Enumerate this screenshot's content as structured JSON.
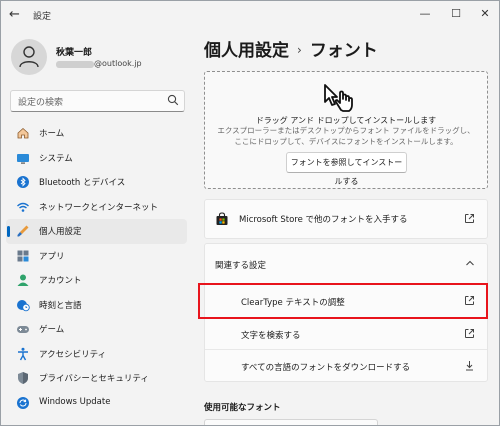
{
  "window": {
    "title": "設定"
  },
  "user": {
    "name": "秋葉一郎",
    "email_domain": "@outlook.jp"
  },
  "search": {
    "placeholder": "設定の検索"
  },
  "nav": {
    "items": [
      {
        "label": "ホーム",
        "icon": "home-icon"
      },
      {
        "label": "システム",
        "icon": "system-icon"
      },
      {
        "label": "Bluetooth とデバイス",
        "icon": "bluetooth-icon"
      },
      {
        "label": "ネットワークとインターネット",
        "icon": "wifi-icon"
      },
      {
        "label": "個人用設定",
        "icon": "brush-icon"
      },
      {
        "label": "アプリ",
        "icon": "apps-icon"
      },
      {
        "label": "アカウント",
        "icon": "account-icon"
      },
      {
        "label": "時刻と言語",
        "icon": "globe-clock-icon"
      },
      {
        "label": "ゲーム",
        "icon": "gamepad-icon"
      },
      {
        "label": "アクセシビリティ",
        "icon": "accessibility-icon"
      },
      {
        "label": "プライバシーとセキュリティ",
        "icon": "shield-icon"
      },
      {
        "label": "Windows Update",
        "icon": "update-icon"
      }
    ],
    "active_index": 4
  },
  "breadcrumb": {
    "parent": "個人用設定",
    "separator": "›",
    "current": "フォント"
  },
  "dropzone": {
    "title": "ドラッグ アンド ドロップしてインストールします",
    "description": "エクスプローラーまたはデスクトップからフォント ファイルをドラッグし、ここにドロップして、デバイスにフォントをインストールします。",
    "button": "フォントを参照してインストールする"
  },
  "store": {
    "label": "Microsoft Store で他のフォントを入手する"
  },
  "related": {
    "title": "関連する設定",
    "items": [
      {
        "label": "ClearType テキストの調整",
        "icon": "external-link-icon"
      },
      {
        "label": "文字を検索する",
        "icon": "external-link-icon"
      },
      {
        "label": "すべての言語のフォントをダウンロードする",
        "icon": "download-icon"
      }
    ]
  },
  "available": {
    "title": "使用可能なフォント"
  },
  "colors": {
    "accent": "#0067c0",
    "highlight": "#e8141c"
  }
}
